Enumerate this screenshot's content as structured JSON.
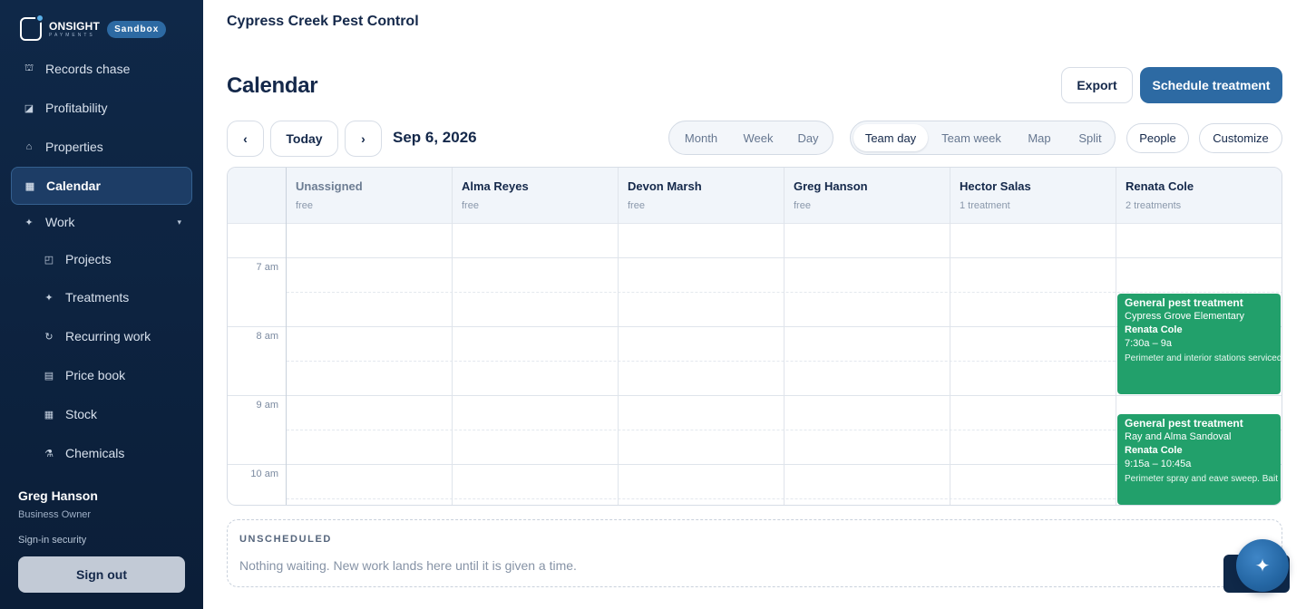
{
  "brand": {
    "name": "ONSIGHT",
    "sub": "PAYMENTS",
    "env_badge": "Sandbox"
  },
  "sidebar": {
    "items": [
      {
        "label": "Records chase",
        "icon": "records-icon"
      },
      {
        "label": "Profitability",
        "icon": "chart-icon"
      },
      {
        "label": "Properties",
        "icon": "house-icon"
      },
      {
        "label": "Calendar",
        "icon": "calendar-icon",
        "active": true
      },
      {
        "label": "Work",
        "icon": "sparkle-icon",
        "expanded": true
      },
      {
        "label": "Projects",
        "icon": "projects-icon"
      },
      {
        "label": "Treatments",
        "icon": "sparkle-icon"
      },
      {
        "label": "Recurring work",
        "icon": "recurring-icon"
      },
      {
        "label": "Price book",
        "icon": "book-icon"
      },
      {
        "label": "Stock",
        "icon": "stock-icon"
      },
      {
        "label": "Chemicals",
        "icon": "flask-icon"
      }
    ],
    "user": {
      "name": "Greg Hanson",
      "role": "Business Owner"
    },
    "security_link": "Sign-in security",
    "sign_out": "Sign out"
  },
  "header": {
    "org_name": "Cypress Creek Pest Control",
    "title": "Calendar"
  },
  "actions": {
    "export": "Export",
    "schedule": "Schedule treatment"
  },
  "toolbar": {
    "prev": "‹",
    "today": "Today",
    "next": "›",
    "date": "Sep 6, 2026",
    "range_views": [
      "Month",
      "Week",
      "Day"
    ],
    "team_views": [
      "Team day",
      "Team week",
      "Map",
      "Split"
    ],
    "active_team_view": "Team day",
    "people": "People",
    "customize": "Customize"
  },
  "calendar": {
    "columns": [
      {
        "name": "Unassigned",
        "status": "free"
      },
      {
        "name": "Alma Reyes",
        "status": "free"
      },
      {
        "name": "Devon Marsh",
        "status": "free"
      },
      {
        "name": "Greg Hanson",
        "status": "free"
      },
      {
        "name": "Hector Salas",
        "status": "1 treatment"
      },
      {
        "name": "Renata Cole",
        "status": "2 treatments"
      }
    ],
    "time_labels": [
      "7 am",
      "8 am",
      "9 am",
      "10 am"
    ],
    "events": [
      {
        "title": "General pest treatment",
        "location": "Cypress Grove Elementary",
        "tech": "Renata Cole",
        "time": "7:30a – 9a",
        "note": "Perimeter and interior stations serviced"
      },
      {
        "title": "General pest treatment",
        "location": "Ray and Alma Sandoval",
        "tech": "Renata Cole",
        "time": "9:15a – 10:45a",
        "note": "Perimeter spray and eave sweep. Bait"
      }
    ]
  },
  "unscheduled": {
    "title": "UNSCHEDULED",
    "empty_text": "Nothing waiting. New work lands here until it is given a time."
  },
  "assistant": {
    "icon": "sparkle-icon"
  }
}
